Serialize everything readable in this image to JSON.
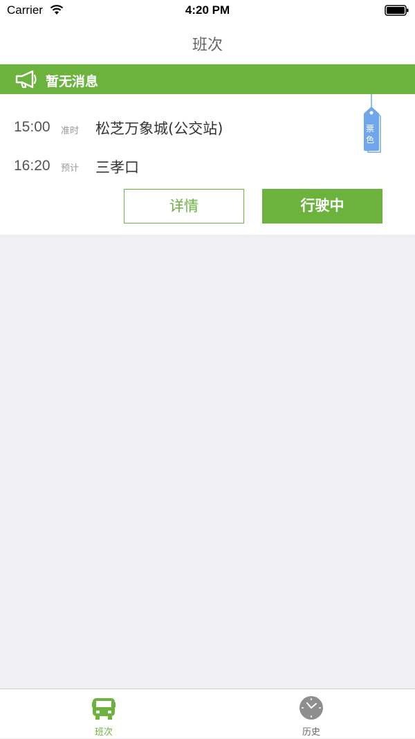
{
  "status_bar": {
    "carrier": "Carrier",
    "time": "4:20 PM",
    "wifi_icon": "wifi-icon",
    "battery_icon": "battery-icon"
  },
  "nav": {
    "title": "班次"
  },
  "notice": {
    "icon": "megaphone-icon",
    "text": "暂无消息",
    "color": "#6cb33e"
  },
  "trip": {
    "departure": {
      "time": "15:00",
      "tag": "准时",
      "station": "松芝万象城(公交站)"
    },
    "arrival": {
      "time": "16:20",
      "tag": "预计",
      "station": "三孝口"
    },
    "ticket_tag": {
      "line1": "票",
      "line2": "色",
      "color": "#6fa6ec"
    },
    "detail_button": "详情",
    "status_button": "行驶中"
  },
  "tab_bar": {
    "items": [
      {
        "label": "班次",
        "icon": "bus-icon",
        "active": true
      },
      {
        "label": "历史",
        "icon": "clock-icon",
        "active": false
      }
    ]
  }
}
